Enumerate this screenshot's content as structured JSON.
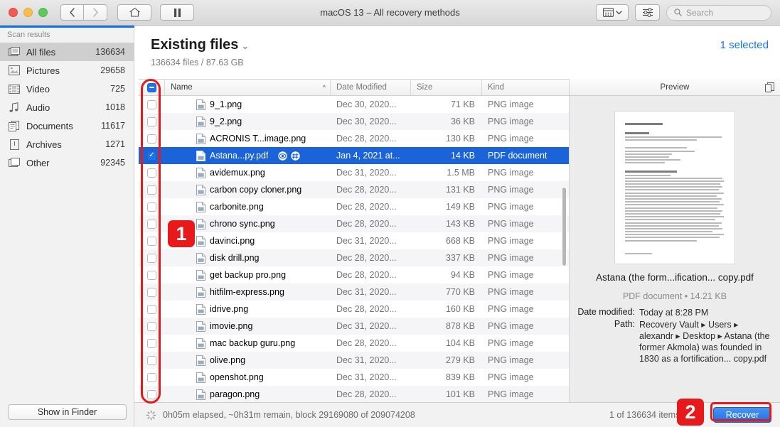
{
  "window": {
    "title": "macOS 13 – All recovery methods",
    "traffic_lights": [
      "close",
      "minimize",
      "maximize"
    ],
    "nav_back": "‹",
    "nav_forward": "›",
    "home_icon": "home-icon",
    "pause_icon": "pause-icon",
    "view_icon": "grid-view-icon",
    "view_caret": "⌄",
    "filter_icon": "sliders-icon",
    "search": {
      "placeholder": "Search",
      "value": "",
      "icon": "search-icon"
    }
  },
  "sidebar": {
    "title": "Scan results",
    "items": [
      {
        "label": "All files",
        "count": "136634",
        "icon": "files-icon",
        "active": true
      },
      {
        "label": "Pictures",
        "count": "29658",
        "icon": "picture-icon",
        "active": false
      },
      {
        "label": "Video",
        "count": "725",
        "icon": "film-icon",
        "active": false
      },
      {
        "label": "Audio",
        "count": "1018",
        "icon": "music-icon",
        "active": false
      },
      {
        "label": "Documents",
        "count": "11617",
        "icon": "document-icon",
        "active": false
      },
      {
        "label": "Archives",
        "count": "1271",
        "icon": "archive-icon",
        "active": false
      },
      {
        "label": "Other",
        "count": "92345",
        "icon": "other-icon",
        "active": false
      }
    ],
    "show_in_finder": "Show in Finder"
  },
  "header": {
    "title": "Existing files",
    "caret": "⌄",
    "subtitle": "136634 files / 87.63 GB",
    "selected_label": "1 selected"
  },
  "table": {
    "columns": [
      "Name",
      "Date Modified",
      "Size",
      "Kind"
    ],
    "sort_indicator": "^",
    "header_checkbox_state": "mixed",
    "rows": [
      {
        "name": "9_1.png",
        "date": "Dec 30, 2020...",
        "size": "71 KB",
        "kind": "PNG image",
        "checked": false,
        "selected": false,
        "badges": []
      },
      {
        "name": "9_2.png",
        "date": "Dec 30, 2020...",
        "size": "36 KB",
        "kind": "PNG image",
        "checked": false,
        "selected": false,
        "badges": []
      },
      {
        "name": "ACRONIS T...image.png",
        "date": "Dec 28, 2020...",
        "size": "130 KB",
        "kind": "PNG image",
        "checked": false,
        "selected": false,
        "badges": []
      },
      {
        "name": "Astana...py.pdf",
        "date": "Jan 4, 2021 at...",
        "size": "14 KB",
        "kind": "PDF document",
        "checked": true,
        "selected": true,
        "badges": [
          "eye-icon",
          "hash-icon"
        ]
      },
      {
        "name": "avidemux.png",
        "date": "Dec 31, 2020...",
        "size": "1.5 MB",
        "kind": "PNG image",
        "checked": false,
        "selected": false,
        "badges": []
      },
      {
        "name": "carbon copy cloner.png",
        "date": "Dec 28, 2020...",
        "size": "131 KB",
        "kind": "PNG image",
        "checked": false,
        "selected": false,
        "badges": []
      },
      {
        "name": "carbonite.png",
        "date": "Dec 28, 2020...",
        "size": "149 KB",
        "kind": "PNG image",
        "checked": false,
        "selected": false,
        "badges": []
      },
      {
        "name": "chrono sync.png",
        "date": "Dec 28, 2020...",
        "size": "143 KB",
        "kind": "PNG image",
        "checked": false,
        "selected": false,
        "badges": []
      },
      {
        "name": "davinci.png",
        "date": "Dec 31, 2020...",
        "size": "668 KB",
        "kind": "PNG image",
        "checked": false,
        "selected": false,
        "badges": []
      },
      {
        "name": "disk drill.png",
        "date": "Dec 28, 2020...",
        "size": "337 KB",
        "kind": "PNG image",
        "checked": false,
        "selected": false,
        "badges": []
      },
      {
        "name": "get backup pro.png",
        "date": "Dec 28, 2020...",
        "size": "94 KB",
        "kind": "PNG image",
        "checked": false,
        "selected": false,
        "badges": []
      },
      {
        "name": "hitfilm-express.png",
        "date": "Dec 31, 2020...",
        "size": "770 KB",
        "kind": "PNG image",
        "checked": false,
        "selected": false,
        "badges": []
      },
      {
        "name": "idrive.png",
        "date": "Dec 28, 2020...",
        "size": "160 KB",
        "kind": "PNG image",
        "checked": false,
        "selected": false,
        "badges": []
      },
      {
        "name": "imovie.png",
        "date": "Dec 31, 2020...",
        "size": "878 KB",
        "kind": "PNG image",
        "checked": false,
        "selected": false,
        "badges": []
      },
      {
        "name": "mac backup guru.png",
        "date": "Dec 28, 2020...",
        "size": "104 KB",
        "kind": "PNG image",
        "checked": false,
        "selected": false,
        "badges": []
      },
      {
        "name": "olive.png",
        "date": "Dec 31, 2020...",
        "size": "279 KB",
        "kind": "PNG image",
        "checked": false,
        "selected": false,
        "badges": []
      },
      {
        "name": "openshot.png",
        "date": "Dec 31, 2020...",
        "size": "839 KB",
        "kind": "PNG image",
        "checked": false,
        "selected": false,
        "badges": []
      },
      {
        "name": "paragon.png",
        "date": "Dec 28, 2020...",
        "size": "101 KB",
        "kind": "PNG image",
        "checked": false,
        "selected": false,
        "badges": []
      }
    ]
  },
  "preview": {
    "title": "Preview",
    "copy_icon": "copy-icon",
    "file_name": "Astana (the form...ification... copy.pdf",
    "kind_size": "PDF document • 14.21 KB",
    "fields": [
      {
        "label": "Date modified:",
        "value": "Today at 8:28 PM"
      },
      {
        "label": "Path:",
        "value": "Recovery Vault ▸ Users ▸ alexandr ▸ Desktop ▸ Astana (the former Akmola) was founded in 1830 as a fortification... copy.pdf"
      }
    ]
  },
  "status": {
    "spinner_icon": "spinner-icon",
    "progress_text": "0h05m elapsed, ~0h31m remain, block 29169080 of 209074208",
    "items_text": "1 of 136634 items, 14 K",
    "recover_label": "Recover"
  },
  "annotations": [
    {
      "badge": "1",
      "target": "checkbox-column"
    },
    {
      "badge": "2",
      "target": "recover-button"
    }
  ],
  "colors": {
    "accent_blue": "#1a73e8",
    "selection_blue": "#1a63d8",
    "annotation_red": "#e8191a"
  }
}
